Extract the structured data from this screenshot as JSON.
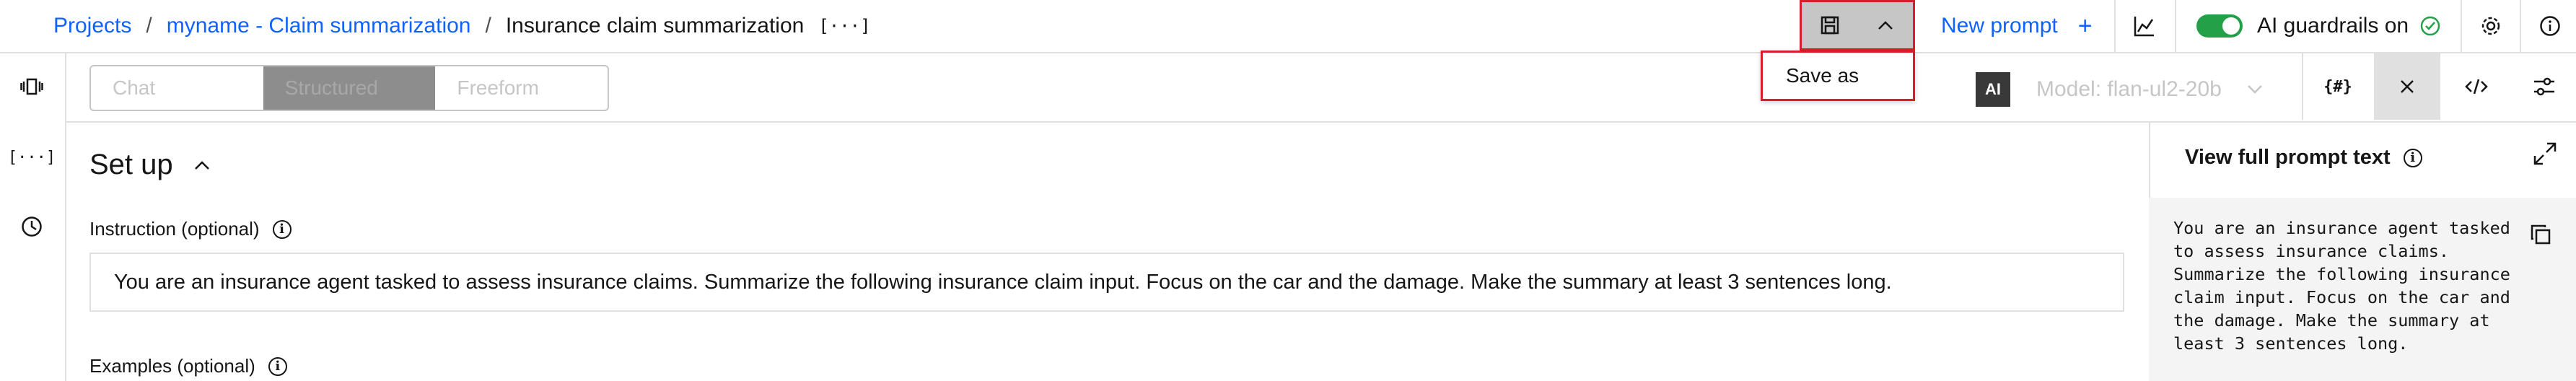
{
  "breadcrumb": {
    "items": [
      "Projects",
      "myname - Claim summarization"
    ],
    "current": "Insurance claim summarization",
    "ellipsis_icon": "[···]"
  },
  "header": {
    "save_icon": "save-icon",
    "new_prompt_label": "New prompt",
    "new_prompt_plus": "+",
    "guardrails_label": "AI guardrails on",
    "guardrails_toggle_on": true
  },
  "save_menu": {
    "items": [
      "Save as"
    ]
  },
  "mode_switcher": {
    "options": [
      "Chat",
      "Structured",
      "Freeform"
    ],
    "selected": "Structured"
  },
  "model_bar": {
    "ai_badge": "AI",
    "model_label": "Model: flan-ul2-20b",
    "var_icon_text": "{#}"
  },
  "setup": {
    "title": "Set up",
    "instruction_label": "Instruction (optional)",
    "instruction_value": "You are an insurance agent tasked to assess insurance claims. Summarize the following insurance claim input. Focus on the car and the damage. Make the summary at least 3 sentences long.",
    "examples_label": "Examples (optional)"
  },
  "prompt_panel": {
    "title": "View full prompt text",
    "text": "You are an insurance agent tasked\nto assess insurance claims.\nSummarize the following insurance\nclaim input. Focus on the car and\nthe damage. Make the summary at\nleast 3 sentences long."
  },
  "colors": {
    "link": "#0f62fe",
    "highlight_border": "#da1e28",
    "toggle_on": "#24a148"
  }
}
